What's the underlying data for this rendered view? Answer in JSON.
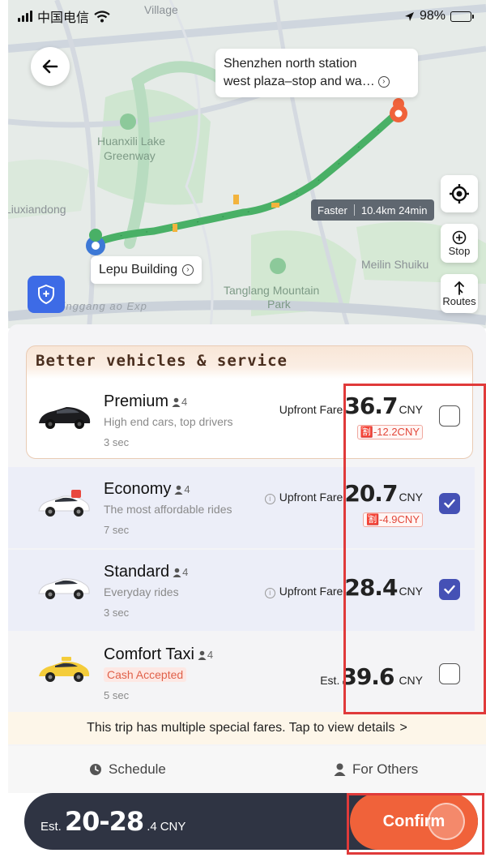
{
  "status_bar": {
    "carrier": "中国电信",
    "battery": "98%",
    "battery_level": 0.98
  },
  "map": {
    "destination_line1": "Shenzhen north station",
    "destination_line2": "west plaza–stop and wa…",
    "origin": "Lepu Building",
    "route_tag": "Faster",
    "route_info": "10.4km 24min",
    "stop_label": "Stop",
    "routes_label": "Routes",
    "labels": {
      "lake": "Huanxili Lake",
      "greenway": "Greenway",
      "liuxiandong": "Liuxiandong",
      "meilin": "Meilin Shuiku",
      "tanglang": "Tanglang Mountain",
      "park": "Park",
      "village": "Village",
      "road": "Jinggang ao Exp"
    }
  },
  "section": {
    "title": "Better vehicles & service"
  },
  "rides": [
    {
      "name": "Premium",
      "seats": "4",
      "description": "High end cars, top drivers",
      "eta": "3 sec",
      "fare_label": "Upfront Fare",
      "amount": "36.7",
      "unit": "CNY",
      "discount": "-12.2CNY",
      "checked": false
    },
    {
      "name": "Economy",
      "seats": "4",
      "description": "The most affordable rides",
      "eta": "7 sec",
      "fare_label": "Upfront Fare",
      "amount": "20.7",
      "unit": "CNY",
      "discount": "-4.9CNY",
      "checked": true
    },
    {
      "name": "Standard",
      "seats": "4",
      "description": "Everyday rides",
      "eta": "3 sec",
      "fare_label": "Upfront Fare",
      "amount": "28.4",
      "unit": "CNY",
      "checked": true
    },
    {
      "name": "Comfort Taxi",
      "seats": "4",
      "description": "Cash Accepted",
      "eta": "5 sec",
      "fare_label": "Est.",
      "amount": "39.6",
      "unit": "CNY",
      "checked": false
    }
  ],
  "notice": {
    "text": "This trip has multiple special fares. Tap to view details",
    "arrow": ">"
  },
  "options": {
    "schedule": "Schedule",
    "for_others": "For Others"
  },
  "bottom": {
    "est_prefix": "Est.",
    "est_range": "20-28",
    "est_decimal": ".4",
    "est_unit": "CNY",
    "confirm": "Confirm"
  },
  "colors": {
    "accent": "#f0623a",
    "selected_check": "#4551b5",
    "route_green": "#49b066",
    "bar_dark": "#2f3443"
  }
}
